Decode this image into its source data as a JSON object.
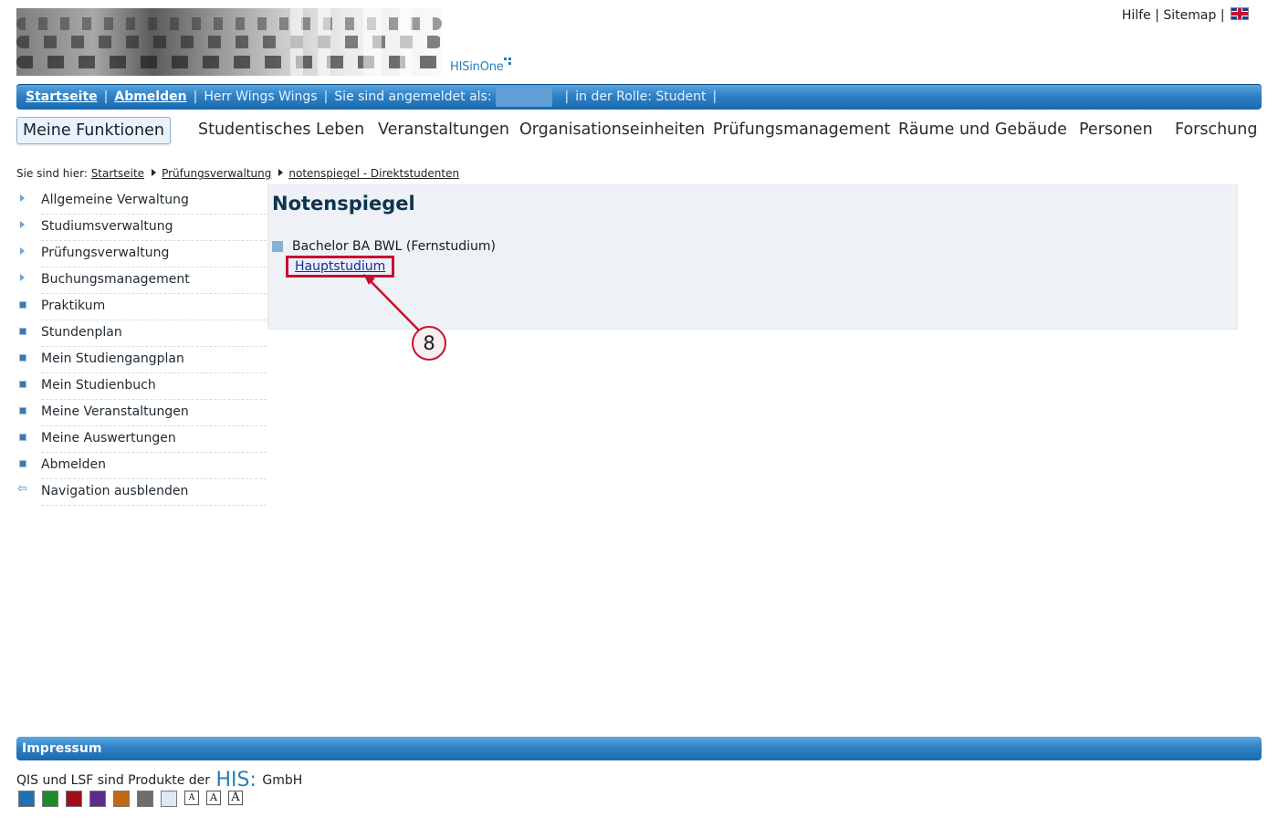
{
  "header": {
    "logo_text": "HISinOne",
    "toplinks": {
      "help": "Hilfe",
      "sep": "|",
      "sitemap": "Sitemap",
      "sep2": "|"
    }
  },
  "topbar": {
    "home": "Startseite",
    "logout": "Abmelden",
    "user": "Herr Wings Wings",
    "logged_in_as": "Sie sind angemeldet als:",
    "role": "in der Rolle: Student",
    "sep": "|"
  },
  "menu": {
    "items": [
      "Meine Funktionen",
      "Studentisches Leben",
      "Veranstaltungen",
      "Organisationseinheiten",
      "Prüfungsmanagement",
      "Räume und Gebäude",
      "Personen",
      "Forschung"
    ]
  },
  "breadcrumb": {
    "prefix": "Sie sind hier:",
    "items": [
      "Startseite",
      "Prüfungsverwaltung",
      "notenspiegel - Direktstudenten"
    ]
  },
  "sidebar": {
    "items": [
      {
        "label": "Allgemeine Verwaltung",
        "icon": "expand-arrow-icon"
      },
      {
        "label": "Studiumsverwaltung",
        "icon": "expand-arrow-icon"
      },
      {
        "label": "Prüfungsverwaltung",
        "icon": "expand-arrow-icon"
      },
      {
        "label": "Buchungsmanagement",
        "icon": "expand-arrow-icon"
      },
      {
        "label": "Praktikum",
        "icon": "bullet-square-icon"
      },
      {
        "label": "Stundenplan",
        "icon": "bullet-square-icon"
      },
      {
        "label": "Mein Studiengangplan",
        "icon": "bullet-square-icon"
      },
      {
        "label": "Mein Studienbuch",
        "icon": "bullet-square-icon"
      },
      {
        "label": "Meine Veranstaltungen",
        "icon": "bullet-square-icon"
      },
      {
        "label": "Meine Auswertungen",
        "icon": "bullet-square-icon"
      },
      {
        "label": "Abmelden",
        "icon": "bullet-square-icon"
      },
      {
        "label": "Navigation ausblenden",
        "icon": "back-arrow-icon"
      }
    ]
  },
  "content": {
    "title": "Notenspiegel",
    "degree": "Bachelor BA BWL (Fernstudium)",
    "link": "Hauptstudium",
    "annotation_number": "8"
  },
  "footer": {
    "bar_label": "Impressum",
    "text_before": "QIS und LSF sind Produkte der",
    "his_logo": "HIS:",
    "text_after": "GmbH",
    "font_size_label": "A",
    "swatch_colors": [
      "#1f6fb5",
      "#1d8a2a",
      "#a10f1a",
      "#5a2a8c",
      "#c06a12",
      "#6e6e6e",
      "#dbe9f6"
    ]
  },
  "colors": {
    "accent_blue": "#2f82c6",
    "annotation_red": "#c8102e"
  }
}
